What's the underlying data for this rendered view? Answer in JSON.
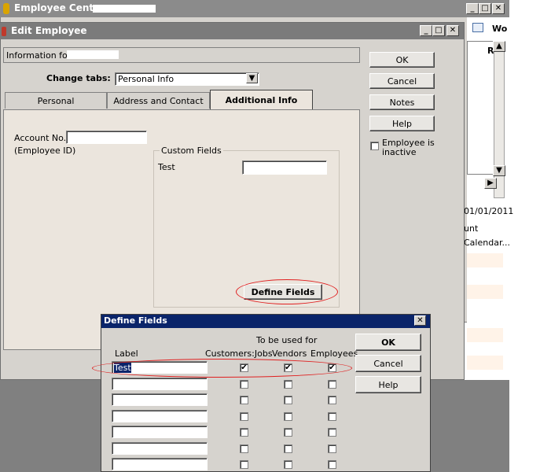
{
  "employee_center": {
    "title": "Employee Center:",
    "right_panel": {
      "tab_label": "Wo",
      "date": "01/01/2011",
      "column": "unt",
      "row": "Calendar..."
    }
  },
  "edit_employee": {
    "title": "Edit Employee",
    "info_for_label": "Information for:",
    "change_tabs_label": "Change tabs:",
    "change_tabs_value": "Personal Info",
    "tabs": [
      "Personal",
      "Address and Contact",
      "Additional Info"
    ],
    "active_tab": "Additional Info",
    "account_no_label": "Account No.",
    "employee_id_label": "(Employee ID)",
    "account_no_value": "",
    "custom_fields_label": "Custom Fields",
    "custom_field_name": "Test",
    "custom_field_value": "",
    "define_fields_button": "Define Fields",
    "buttons": {
      "ok": "OK",
      "cancel": "Cancel",
      "notes": "Notes",
      "help": "Help"
    },
    "inactive_label_1": "Employee is",
    "inactive_label_2": "inactive"
  },
  "define_fields": {
    "title": "Define Fields",
    "group_header": "To be used for",
    "label_header": "Label",
    "col_customers": "Customers:Jobs",
    "col_vendors": "Vendors",
    "col_employees": "Employees",
    "rows": [
      {
        "label": "Test",
        "customers": true,
        "vendors": true,
        "employees": true
      },
      {
        "label": "",
        "customers": false,
        "vendors": false,
        "employees": false
      },
      {
        "label": "",
        "customers": false,
        "vendors": false,
        "employees": false
      },
      {
        "label": "",
        "customers": false,
        "vendors": false,
        "employees": false
      },
      {
        "label": "",
        "customers": false,
        "vendors": false,
        "employees": false
      },
      {
        "label": "",
        "customers": false,
        "vendors": false,
        "employees": false
      },
      {
        "label": "",
        "customers": false,
        "vendors": false,
        "employees": false
      }
    ],
    "buttons": {
      "ok": "OK",
      "cancel": "Cancel",
      "help": "Help"
    }
  },
  "colors": {
    "highlight_oval": "#e02020",
    "dialog_titlebar": "#0a246a",
    "background_gray": "#808080"
  }
}
